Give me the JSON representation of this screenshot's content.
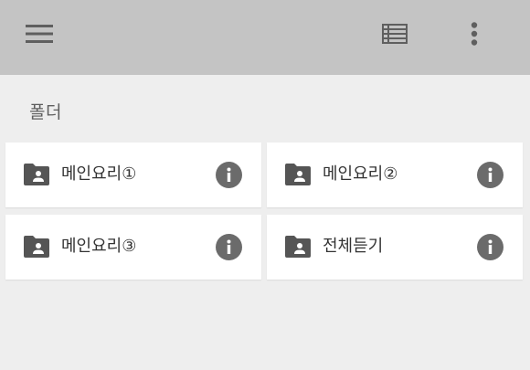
{
  "toolbar": {
    "menu_icon": "hamburger-menu-icon",
    "view_icon": "list-view-icon",
    "more_icon": "more-vertical-icon"
  },
  "section": {
    "title": "폴더"
  },
  "folders": [
    {
      "label": "메인요리①",
      "icon": "shared-folder-icon",
      "action_icon": "info-icon"
    },
    {
      "label": "메인요리②",
      "icon": "shared-folder-icon",
      "action_icon": "info-icon"
    },
    {
      "label": "메인요리③",
      "icon": "shared-folder-icon",
      "action_icon": "info-icon"
    },
    {
      "label": "전체듣기",
      "icon": "shared-folder-icon",
      "action_icon": "info-icon"
    }
  ],
  "colors": {
    "toolbar_bg": "#c4c4c4",
    "page_bg": "#eeeeee",
    "card_bg": "#ffffff",
    "icon_gray": "#5f5f5f",
    "folder_icon": "#555555",
    "info_icon": "#6b6b6b",
    "text": "#333333"
  }
}
